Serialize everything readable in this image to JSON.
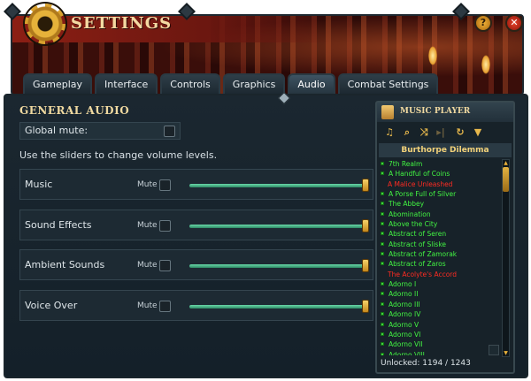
{
  "header": {
    "title": "SETTINGS",
    "help_label": "?",
    "close_label": "✕"
  },
  "tabs": [
    {
      "label": "Gameplay",
      "active": false
    },
    {
      "label": "Interface",
      "active": false
    },
    {
      "label": "Controls",
      "active": false
    },
    {
      "label": "Graphics",
      "active": false
    },
    {
      "label": "Audio",
      "active": true
    },
    {
      "label": "Combat Settings",
      "active": false
    }
  ],
  "audio": {
    "section_title": "GENERAL AUDIO",
    "global_mute_label": "Global mute:",
    "hint": "Use the sliders to change volume levels.",
    "mute_label": "Mute",
    "channels": [
      {
        "label": "Music",
        "level": 1.0,
        "muted": false
      },
      {
        "label": "Sound Effects",
        "level": 1.0,
        "muted": false
      },
      {
        "label": "Ambient Sounds",
        "level": 1.0,
        "muted": false
      },
      {
        "label": "Voice Over",
        "level": 1.0,
        "muted": false
      }
    ]
  },
  "music_player": {
    "title": "MUSIC PLAYER",
    "now_playing": "Burthorpe Dilemma",
    "tracks": [
      {
        "name": "7th Realm",
        "unlocked": true
      },
      {
        "name": "A Handful of Coins",
        "unlocked": true
      },
      {
        "name": "A Malice Unleashed",
        "unlocked": false
      },
      {
        "name": "A Porse Full of Silver",
        "unlocked": true
      },
      {
        "name": "The Abbey",
        "unlocked": true
      },
      {
        "name": "Abomination",
        "unlocked": true
      },
      {
        "name": "Above the City",
        "unlocked": true
      },
      {
        "name": "Abstract of Seren",
        "unlocked": true
      },
      {
        "name": "Abstract of Sliske",
        "unlocked": true
      },
      {
        "name": "Abstract of Zamorak",
        "unlocked": true
      },
      {
        "name": "Abstract of Zaros",
        "unlocked": true
      },
      {
        "name": "The Acolyte's Accord",
        "unlocked": false
      },
      {
        "name": "Adorno I",
        "unlocked": true
      },
      {
        "name": "Adorno II",
        "unlocked": true
      },
      {
        "name": "Adorno III",
        "unlocked": true
      },
      {
        "name": "Adorno IV",
        "unlocked": true
      },
      {
        "name": "Adorno V",
        "unlocked": true
      },
      {
        "name": "Adorno VI",
        "unlocked": true
      },
      {
        "name": "Adorno VII",
        "unlocked": true
      },
      {
        "name": "Adorno VIII",
        "unlocked": true
      }
    ],
    "unlocked_text": "Unlocked: 1194 / 1243",
    "tool_icons": [
      "playlist-icon",
      "search-icon",
      "shuffle-icon",
      "skip-icon",
      "loop-icon",
      "filter-icon"
    ]
  },
  "colors": {
    "unlocked": "#42f442",
    "locked": "#ff2b22",
    "gold": "#f0d9a0"
  }
}
